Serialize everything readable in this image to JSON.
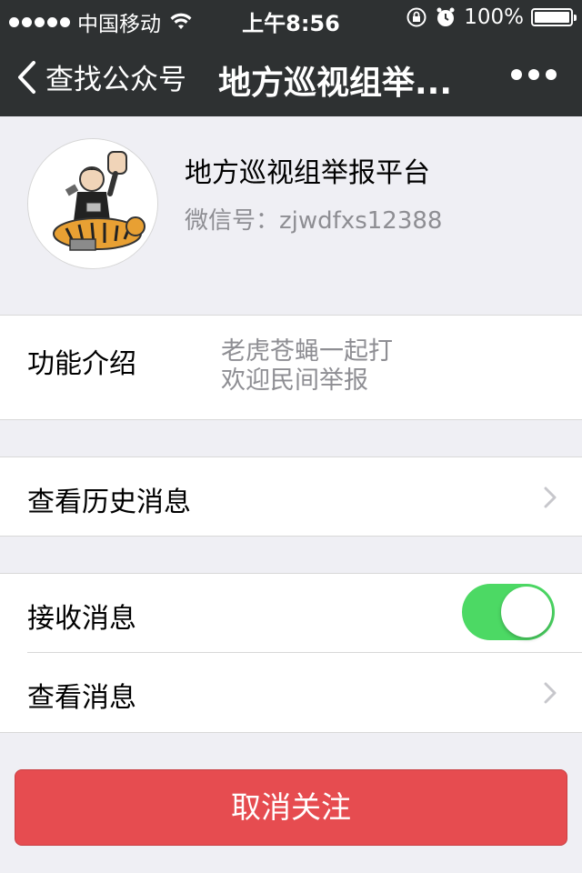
{
  "status_bar": {
    "carrier": "中国移动",
    "time": "上午8:56",
    "battery": "100%",
    "signal_bars": 5,
    "icons": [
      "signal-dots-icon",
      "wifi-icon",
      "lock-rotation-icon",
      "alarm-icon",
      "battery-icon"
    ]
  },
  "nav": {
    "back_label": "查找公众号",
    "title": "地方巡视组举...",
    "icons": [
      "chevron-left-icon",
      "more-icon"
    ]
  },
  "profile": {
    "name": "地方巡视组举报平台",
    "wechat_id_label": "微信号：",
    "wechat_id": "zjwdfxs12388",
    "avatar_icon": "tiger-cartoon-avatar"
  },
  "intro": {
    "label": "功能介绍",
    "line1": "老虎苍蝇一起打",
    "line2": "欢迎民间举报"
  },
  "history": {
    "label": "查看历史消息"
  },
  "settings": {
    "receive_label": "接收消息",
    "receive_enabled": true,
    "view_label": "查看消息"
  },
  "actions": {
    "unfollow_label": "取消关注"
  },
  "colors": {
    "bar_bg": "#2e3132",
    "page_bg": "#efeff4",
    "toggle_on": "#4cd964",
    "danger": "#e64c50",
    "secondary_text": "#8e8e93"
  }
}
